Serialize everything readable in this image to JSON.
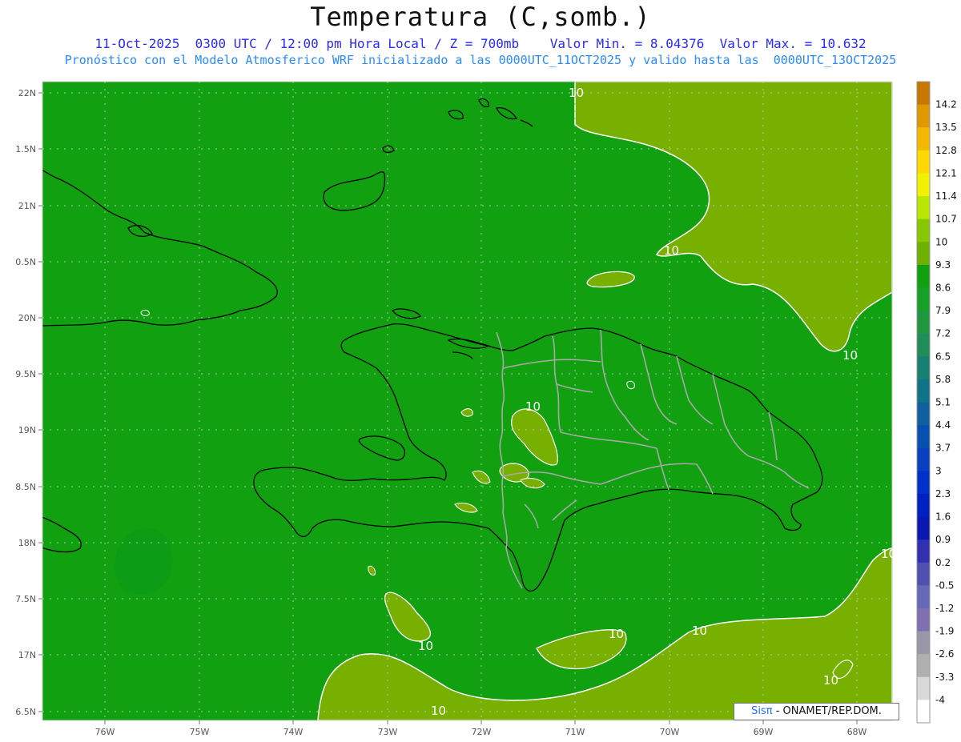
{
  "header": {
    "title": "Temperatura (C,somb.)",
    "line1": "11-Oct-2025  0300 UTC / 12:00 pm Hora Local / Z = 700mb    Valor Min. = 8.04376  Valor Max. = 10.632",
    "line2": "Pronóstico con el Modelo Atmosferico WRF inicializado a las 0000UTC_11OCT2025 y valido hasta las  0000UTC_13OCT2025"
  },
  "map": {
    "lat_labels": [
      "22N",
      "1.5N",
      "21N",
      "0.5N",
      "20N",
      "9.5N",
      "19N",
      "8.5N",
      "18N",
      "7.5N",
      "17N",
      "6.5N"
    ],
    "lon_labels": [
      "76W",
      "75W",
      "74W",
      "73W",
      "72W",
      "71W",
      "70W",
      "69W",
      "68W"
    ],
    "contour_labels": [
      "10",
      "10",
      "10",
      "10",
      "10",
      "10",
      "10",
      "10",
      "10",
      "10"
    ],
    "colors": {
      "warm_zone": "#78b000",
      "base_zone": "#10a010",
      "coast": "#000000",
      "borders": "#a0a0a0",
      "contour": "#ffffff"
    }
  },
  "colorbar": {
    "levels": [
      "14.2",
      "13.5",
      "12.8",
      "12.1",
      "11.4",
      "10.7",
      "10",
      "9.3",
      "8.6",
      "7.9",
      "7.2",
      "6.5",
      "5.8",
      "5.1",
      "4.4",
      "3.7",
      "3",
      "2.3",
      "1.6",
      "0.9",
      "0.2",
      "-0.5",
      "-1.2",
      "-1.9",
      "-2.6",
      "-3.3",
      "-4"
    ],
    "colors": [
      "#c87800",
      "#e09800",
      "#f5b800",
      "#ffd800",
      "#f0f000",
      "#b8e800",
      "#88c800",
      "#70b000",
      "#10a010",
      "#18a028",
      "#209840",
      "#208c58",
      "#188070",
      "#107488",
      "#1060a0",
      "#0850b0",
      "#0840c0",
      "#0030c8",
      "#0020c0",
      "#0818b0",
      "#3030b0",
      "#5050b0",
      "#6868b8",
      "#8070b0",
      "#9898a8",
      "#b0b0b0",
      "#d8d8d8",
      "#ffffff"
    ]
  },
  "credit": {
    "sis": "Sisπ",
    "text": " - ONAMET/REP.DOM."
  }
}
